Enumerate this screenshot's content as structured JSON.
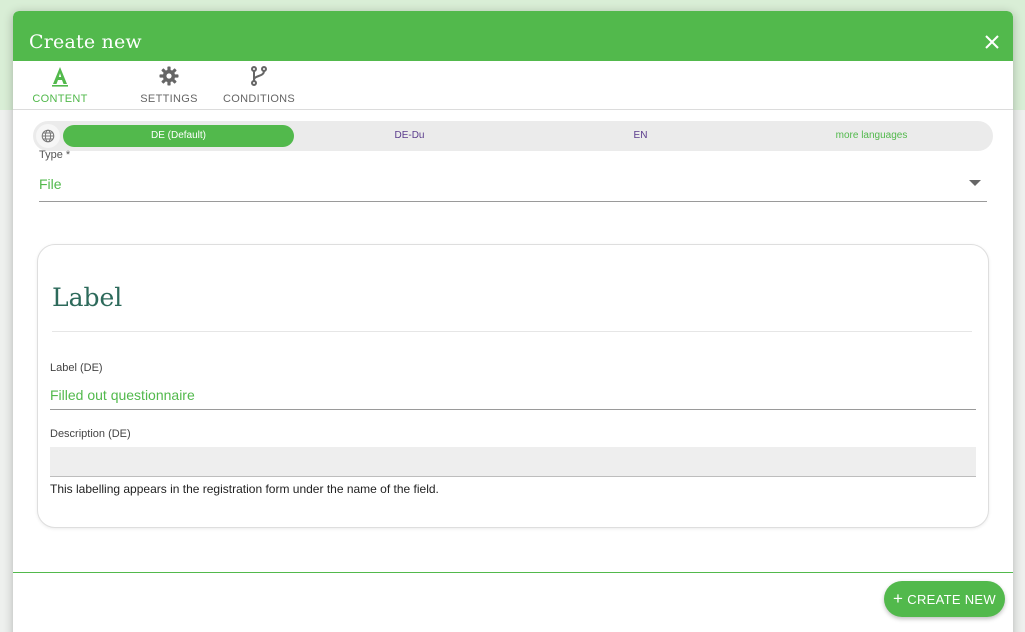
{
  "dialog": {
    "title": "Create new",
    "close_icon": "close-icon"
  },
  "tabs": [
    {
      "label": "CONTENT",
      "icon": "text-format-icon",
      "active": true
    },
    {
      "label": "SETTINGS",
      "icon": "gear-icon",
      "active": false
    },
    {
      "label": "CONDITIONS",
      "icon": "branch-icon",
      "active": false
    }
  ],
  "languages": {
    "icon": "globe-icon",
    "items": [
      {
        "label": "DE (Default)",
        "active": true
      },
      {
        "label": "DE-Du",
        "active": false
      },
      {
        "label": "EN",
        "active": false
      },
      {
        "label": "more languages",
        "active": false
      }
    ]
  },
  "type_field": {
    "label": "Type *",
    "value": "File"
  },
  "label_card": {
    "title": "Label",
    "label_field": {
      "label": "Label (DE)",
      "value": "Filled out questionnaire"
    },
    "description_field": {
      "label": "Description (DE)",
      "value": ""
    },
    "hint": "This labelling appears in the registration form under the name of the field."
  },
  "footer": {
    "create_label": "CREATE NEW"
  },
  "colors": {
    "primary": "#52b94c",
    "title_teal": "#2d6a5b",
    "language_text": "#5a3b8c"
  }
}
